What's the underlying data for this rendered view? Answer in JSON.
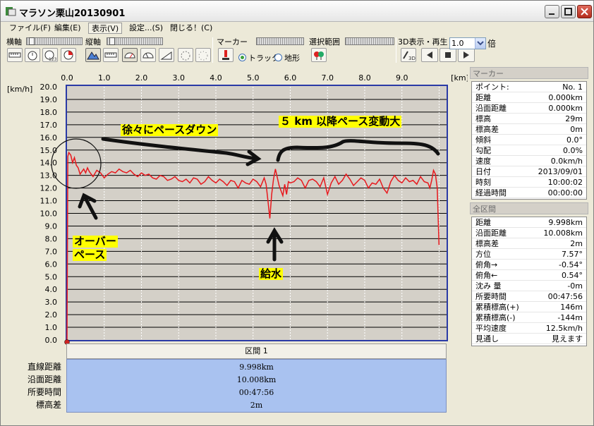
{
  "window": {
    "title": "マラソン栗山20130901"
  },
  "menu": [
    {
      "label": "ファイル(F)"
    },
    {
      "label": "編集(E)"
    },
    {
      "label": "表示(V)"
    },
    {
      "label": "設定...(S)"
    },
    {
      "label": "閉じる！(C)"
    }
  ],
  "toolbar": {
    "x_axis_label": "横軸",
    "y_axis_label": "縦軸",
    "marker_label": "マーカー",
    "range_label": "選択範囲",
    "play3d_label": "3D表示・再生",
    "speed_value": "1.0",
    "speed_unit": "倍",
    "track_label": "トラック",
    "terrain_label": "地形"
  },
  "chart_data": {
    "type": "line",
    "x_unit": "[km]",
    "y_unit": "[km/h]",
    "xlim": [
      0,
      10.2
    ],
    "ylim": [
      0,
      20
    ],
    "x_ticks": [
      "0.0",
      "1.0",
      "2.0",
      "3.0",
      "4.0",
      "5.0",
      "6.0",
      "7.0",
      "8.0",
      "9.0"
    ],
    "y_ticks": [
      "20.0",
      "19.0",
      "18.0",
      "17.0",
      "16.0",
      "15.0",
      "14.0",
      "13.0",
      "12.0",
      "11.0",
      "10.0",
      "9.0",
      "8.0",
      "7.0",
      "6.0",
      "5.0",
      "4.0",
      "3.0",
      "2.0",
      "1.0",
      "0.0"
    ],
    "grid": true,
    "x": [
      0.0,
      0.02,
      0.05,
      0.1,
      0.15,
      0.2,
      0.25,
      0.3,
      0.35,
      0.4,
      0.45,
      0.5,
      0.55,
      0.6,
      0.7,
      0.8,
      0.9,
      1.0,
      1.1,
      1.2,
      1.3,
      1.4,
      1.5,
      1.6,
      1.7,
      1.8,
      1.9,
      2.0,
      2.1,
      2.2,
      2.3,
      2.4,
      2.5,
      2.6,
      2.7,
      2.8,
      2.9,
      3.0,
      3.1,
      3.2,
      3.3,
      3.4,
      3.5,
      3.6,
      3.7,
      3.8,
      3.9,
      4.0,
      4.1,
      4.2,
      4.3,
      4.4,
      4.5,
      4.6,
      4.7,
      4.8,
      4.9,
      5.0,
      5.1,
      5.2,
      5.3,
      5.35,
      5.4,
      5.45,
      5.5,
      5.55,
      5.6,
      5.7,
      5.8,
      5.85,
      5.9,
      5.95,
      6.0,
      6.1,
      6.2,
      6.3,
      6.4,
      6.5,
      6.6,
      6.7,
      6.8,
      6.9,
      7.0,
      7.1,
      7.2,
      7.3,
      7.4,
      7.5,
      7.6,
      7.7,
      7.8,
      7.9,
      8.0,
      8.1,
      8.2,
      8.3,
      8.4,
      8.5,
      8.6,
      8.7,
      8.8,
      8.9,
      9.0,
      9.1,
      9.2,
      9.3,
      9.4,
      9.5,
      9.6,
      9.7,
      9.75,
      9.8,
      9.85,
      9.9,
      9.95,
      9.998
    ],
    "y": [
      0.0,
      14.5,
      14.8,
      14.6,
      14.0,
      14.4,
      13.8,
      13.6,
      13.1,
      13.3,
      13.5,
      13.2,
      13.6,
      13.3,
      12.9,
      13.4,
      13.2,
      12.8,
      13.1,
      13.3,
      13.2,
      13.5,
      13.3,
      13.2,
      13.4,
      13.1,
      12.9,
      13.2,
      13.0,
      13.1,
      12.8,
      12.7,
      13.0,
      12.9,
      12.6,
      12.7,
      12.9,
      12.6,
      12.5,
      12.7,
      12.4,
      12.8,
      12.7,
      12.3,
      12.5,
      12.9,
      12.6,
      12.4,
      12.7,
      12.5,
      12.2,
      12.6,
      12.5,
      12.0,
      12.6,
      12.4,
      12.3,
      12.7,
      12.5,
      12.1,
      12.8,
      12.3,
      11.0,
      9.6,
      11.5,
      12.7,
      13.5,
      12.2,
      11.4,
      12.3,
      11.5,
      12.5,
      12.4,
      12.5,
      12.8,
      12.6,
      12.0,
      12.6,
      12.7,
      12.5,
      12.1,
      12.8,
      11.5,
      12.4,
      12.9,
      12.3,
      12.6,
      13.1,
      12.7,
      12.2,
      12.5,
      12.8,
      12.6,
      12.0,
      12.4,
      12.3,
      12.7,
      12.0,
      11.6,
      12.5,
      13.0,
      12.6,
      12.4,
      12.8,
      12.5,
      12.6,
      12.3,
      12.9,
      12.5,
      12.4,
      12.0,
      12.6,
      13.4,
      13.1,
      12.0,
      7.5,
      0.0
    ]
  },
  "annotations": {
    "gradual": "徐々にペースダウン",
    "after5km": "５ km 以降ペース変動大",
    "over1": "オーバー",
    "over2": "ペース",
    "water": "給水"
  },
  "marker_section": {
    "title": "マーカー",
    "rows": [
      {
        "k": "ポイント:",
        "v": "No. 1"
      },
      {
        "k": "距離",
        "v": "0.000km"
      },
      {
        "k": "沿面距離",
        "v": "0.000km"
      },
      {
        "k": "標高",
        "v": "29m"
      },
      {
        "k": "標高差",
        "v": "0m"
      },
      {
        "k": "傾斜",
        "v": "0.0°"
      },
      {
        "k": "勾配",
        "v": "0.0%"
      },
      {
        "k": "速度",
        "v": "0.0km/h"
      },
      {
        "k": "日付",
        "v": "2013/09/01"
      },
      {
        "k": "時刻",
        "v": "10:00:02"
      },
      {
        "k": "経過時間",
        "v": "00:00:00"
      }
    ]
  },
  "total_section": {
    "title": "全区間",
    "rows": [
      {
        "k": "距離",
        "v": "9.998km"
      },
      {
        "k": "沿面距離",
        "v": "10.008km"
      },
      {
        "k": "標高差",
        "v": "2m"
      },
      {
        "k": "方位",
        "v": "7.57°"
      },
      {
        "k": "俯角→",
        "v": "-0.54°"
      },
      {
        "k": "俯角←",
        "v": "0.54°"
      },
      {
        "k": "沈み 量",
        "v": "-0m"
      },
      {
        "k": "所要時間",
        "v": "00:47:56"
      },
      {
        "k": "累積標高(+)",
        "v": "146m"
      },
      {
        "k": "累積標高(-)",
        "v": "-144m"
      },
      {
        "k": "平均速度",
        "v": "12.5km/h"
      },
      {
        "k": "見通し",
        "v": "見えます"
      }
    ]
  },
  "summary": {
    "header": "区間 1",
    "labels": [
      "直線距離",
      "沿面距離",
      "所要時間",
      "標高差"
    ],
    "values": [
      "9.998km",
      "10.008km",
      "00:47:56",
      "2m"
    ]
  },
  "colors": {
    "line": "#e8191e",
    "frame": "#2a3aa6",
    "annotation_bg": "#ffff00"
  }
}
